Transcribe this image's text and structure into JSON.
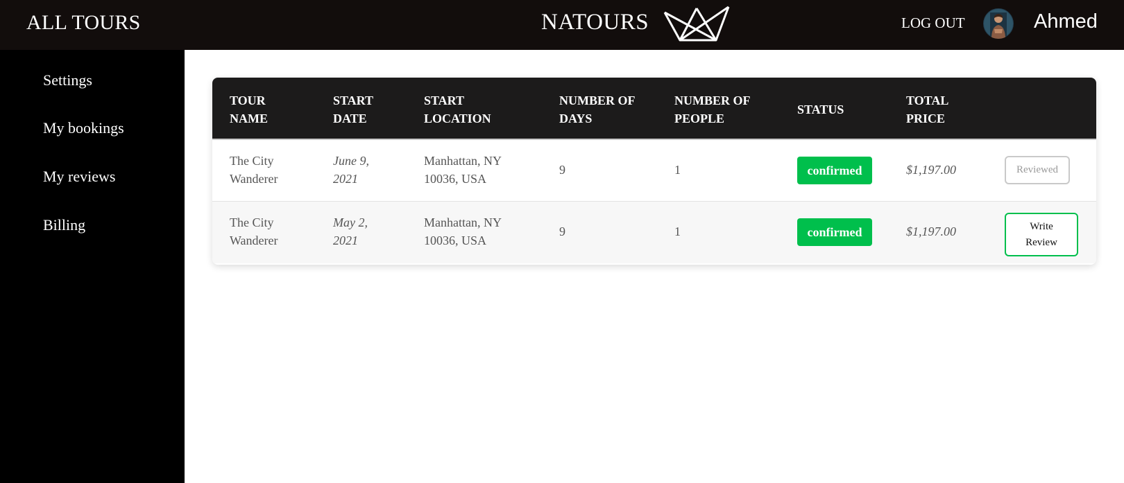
{
  "header": {
    "all_tours": "ALL TOURS",
    "brand": "NATOURS",
    "logo_icon": "crown-logo-icon",
    "logout": "LOG OUT",
    "user_name": "Ahmed"
  },
  "sidebar": {
    "items": [
      {
        "label": "Settings"
      },
      {
        "label": "My bookings"
      },
      {
        "label": "My reviews"
      },
      {
        "label": "Billing"
      }
    ]
  },
  "table": {
    "headers": [
      "TOUR\nNAME",
      "START\nDATE",
      "START\nLOCATION",
      "NUMBER OF\nDAYS",
      "NUMBER OF\nPEOPLE",
      "STATUS",
      "TOTAL\nPRICE"
    ],
    "rows": [
      {
        "tour_name": "The City\nWanderer",
        "start_date": "June 9,\n2021",
        "start_location": "Manhattan, NY\n10036, USA",
        "days": "9",
        "people": "1",
        "status": "confirmed",
        "price": "$1,197.00",
        "action": "Reviewed"
      },
      {
        "tour_name": "The City\nWanderer",
        "start_date": "May 2,\n2021",
        "start_location": "Manhattan, NY\n10036, USA",
        "days": "9",
        "people": "1",
        "status": "confirmed",
        "price": "$1,197.00",
        "action": "Write\nReview"
      }
    ]
  },
  "colors": {
    "header_bg": "#120d0c",
    "sidebar_bg": "#000000",
    "table_header_bg": "#1c1b1b",
    "status_green": "#00bf4c",
    "alt_row_bg": "#f7f7f7"
  }
}
